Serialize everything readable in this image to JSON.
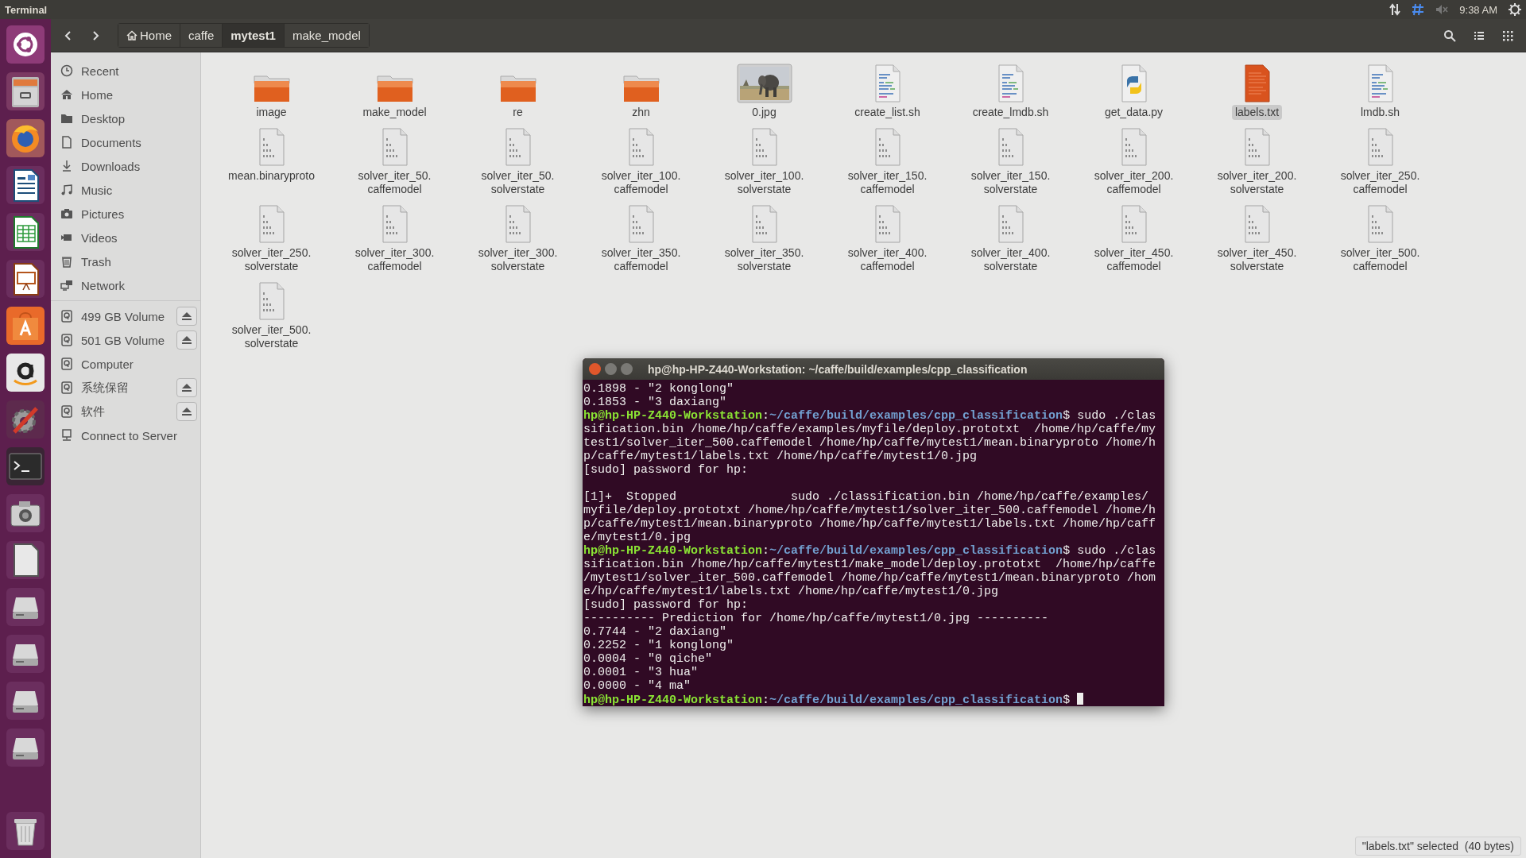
{
  "top_bar": {
    "app_title": "Terminal",
    "clock": "9:38 AM"
  },
  "file_manager": {
    "breadcrumbs": [
      {
        "label": "Home",
        "kind": "home",
        "selected": false
      },
      {
        "label": "caffe",
        "kind": "folder",
        "selected": false
      },
      {
        "label": "mytest1",
        "kind": "folder",
        "selected": true
      },
      {
        "label": "make_model",
        "kind": "folder",
        "selected": false
      }
    ],
    "sidebar": {
      "places": [
        {
          "label": "Recent"
        },
        {
          "label": "Home"
        },
        {
          "label": "Desktop"
        },
        {
          "label": "Documents"
        },
        {
          "label": "Downloads"
        },
        {
          "label": "Music"
        },
        {
          "label": "Pictures"
        },
        {
          "label": "Videos"
        },
        {
          "label": "Trash"
        },
        {
          "label": "Network"
        }
      ],
      "devices": [
        {
          "label": "499 GB Volume",
          "kind": "drive",
          "eject": true
        },
        {
          "label": "501 GB Volume",
          "kind": "drive",
          "eject": true
        },
        {
          "label": "Computer",
          "kind": "drive",
          "eject": false
        },
        {
          "label": "系统保留",
          "kind": "drive",
          "eject": true
        },
        {
          "label": "软件",
          "kind": "drive",
          "eject": true
        },
        {
          "label": "Connect to Server",
          "kind": "server",
          "eject": false
        }
      ]
    },
    "files": [
      {
        "name": "image",
        "kind": "folder",
        "selected": false
      },
      {
        "name": "make_model",
        "kind": "folder",
        "selected": false
      },
      {
        "name": "re",
        "kind": "folder",
        "selected": false
      },
      {
        "name": "zhn",
        "kind": "folder",
        "selected": false
      },
      {
        "name": "0.jpg",
        "kind": "picture",
        "selected": false
      },
      {
        "name": "create_list.sh",
        "kind": "script",
        "selected": false
      },
      {
        "name": "create_lmdb.sh",
        "kind": "script",
        "selected": false
      },
      {
        "name": "get_data.py",
        "kind": "python",
        "selected": false
      },
      {
        "name": "labels.txt",
        "kind": "text",
        "selected": true
      },
      {
        "name": "lmdb.sh",
        "kind": "script",
        "selected": false
      },
      {
        "name": "mean.binaryproto",
        "kind": "binary",
        "selected": false
      },
      {
        "name": "solver_iter_50.caffemodel",
        "kind": "binary",
        "selected": false
      },
      {
        "name": "solver_iter_50.solverstate",
        "kind": "binary",
        "selected": false
      },
      {
        "name": "solver_iter_100.caffemodel",
        "kind": "binary",
        "selected": false
      },
      {
        "name": "solver_iter_100.solverstate",
        "kind": "binary",
        "selected": false
      },
      {
        "name": "solver_iter_150.caffemodel",
        "kind": "binary",
        "selected": false
      },
      {
        "name": "solver_iter_150.solverstate",
        "kind": "binary",
        "selected": false
      },
      {
        "name": "solver_iter_200.caffemodel",
        "kind": "binary",
        "selected": false
      },
      {
        "name": "solver_iter_200.solverstate",
        "kind": "binary",
        "selected": false
      },
      {
        "name": "solver_iter_250.caffemodel",
        "kind": "binary",
        "selected": false
      },
      {
        "name": "solver_iter_250.solverstate",
        "kind": "binary",
        "selected": false
      },
      {
        "name": "solver_iter_300.caffemodel",
        "kind": "binary",
        "selected": false
      },
      {
        "name": "solver_iter_300.solverstate",
        "kind": "binary",
        "selected": false
      },
      {
        "name": "solver_iter_350.caffemodel",
        "kind": "binary",
        "selected": false
      },
      {
        "name": "solver_iter_350.solverstate",
        "kind": "binary",
        "selected": false
      },
      {
        "name": "solver_iter_400.caffemodel",
        "kind": "binary",
        "selected": false
      },
      {
        "name": "solver_iter_400.solverstate",
        "kind": "binary",
        "selected": false
      },
      {
        "name": "solver_iter_450.caffemodel",
        "kind": "binary",
        "selected": false
      },
      {
        "name": "solver_iter_450.solverstate",
        "kind": "binary",
        "selected": false
      },
      {
        "name": "solver_iter_500.caffemodel",
        "kind": "binary",
        "selected": false
      },
      {
        "name": "solver_iter_500.solverstate",
        "kind": "binary",
        "selected": false
      }
    ],
    "status": "\"labels.txt\" selected  (40 bytes)"
  },
  "terminal": {
    "title": "hp@hp-HP-Z440-Workstation: ~/caffe/build/examples/cpp_classification",
    "lines": [
      {
        "kind": "output",
        "text": "0.1898 - \"2 konglong\""
      },
      {
        "kind": "output",
        "text": "0.1853 - \"3 daxiang\""
      },
      {
        "kind": "prompt",
        "host": "hp@hp-HP-Z440-Workstation",
        "separator": ":",
        "path": "~/caffe/build/examples/cpp_classification",
        "command": "$ sudo ./clas",
        "cursor": false
      },
      {
        "kind": "output",
        "text": "sification.bin /home/hp/caffe/examples/myfile/deploy.prototxt  /home/hp/caffe/my"
      },
      {
        "kind": "output",
        "text": "test1/solver_iter_500.caffemodel /home/hp/caffe/mytest1/mean.binaryproto /home/h"
      },
      {
        "kind": "output",
        "text": "p/caffe/mytest1/labels.txt /home/hp/caffe/mytest1/0.jpg"
      },
      {
        "kind": "output",
        "text": "[sudo] password for hp:"
      },
      {
        "kind": "blank"
      },
      {
        "kind": "output",
        "text": "[1]+  Stopped                sudo ./classification.bin /home/hp/caffe/examples/"
      },
      {
        "kind": "output",
        "text": "myfile/deploy.prototxt /home/hp/caffe/mytest1/solver_iter_500.caffemodel /home/h"
      },
      {
        "kind": "output",
        "text": "p/caffe/mytest1/mean.binaryproto /home/hp/caffe/mytest1/labels.txt /home/hp/caff"
      },
      {
        "kind": "output",
        "text": "e/mytest1/0.jpg"
      },
      {
        "kind": "prompt",
        "host": "hp@hp-HP-Z440-Workstation",
        "separator": ":",
        "path": "~/caffe/build/examples/cpp_classification",
        "command": "$ sudo ./clas",
        "cursor": false
      },
      {
        "kind": "output",
        "text": "sification.bin /home/hp/caffe/mytest1/make_model/deploy.prototxt  /home/hp/caffe"
      },
      {
        "kind": "output",
        "text": "/mytest1/solver_iter_500.caffemodel /home/hp/caffe/mytest1/mean.binaryproto /hom"
      },
      {
        "kind": "output",
        "text": "e/hp/caffe/mytest1/labels.txt /home/hp/caffe/mytest1/0.jpg"
      },
      {
        "kind": "output",
        "text": "[sudo] password for hp:"
      },
      {
        "kind": "output",
        "text": "---------- Prediction for /home/hp/caffe/mytest1/0.jpg ----------"
      },
      {
        "kind": "output",
        "text": "0.7744 - \"2 daxiang\""
      },
      {
        "kind": "output",
        "text": "0.2252 - \"1 konglong\""
      },
      {
        "kind": "output",
        "text": "0.0004 - \"0 qiche\""
      },
      {
        "kind": "output",
        "text": "0.0001 - \"3 hua\""
      },
      {
        "kind": "output",
        "text": "0.0000 - \"4 ma\""
      },
      {
        "kind": "prompt",
        "host": "hp@hp-HP-Z440-Workstation",
        "separator": ":",
        "path": "~/caffe/build/examples/cpp_classification",
        "command": "$",
        "cursor": true
      }
    ]
  }
}
